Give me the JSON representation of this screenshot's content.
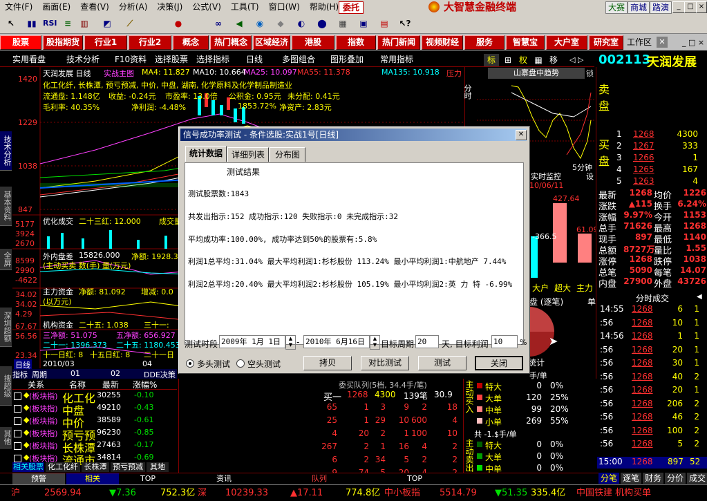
{
  "menu": [
    "文件(F)",
    "画面(E)",
    "查看(V)",
    "分析(A)",
    "决策(J)",
    "公式(V)",
    "工具(T)",
    "窗口(W)",
    "帮助(H)"
  ],
  "menu_extra": {
    "entrust": "委托",
    "brand": "大智慧金融终端",
    "links": [
      "大赛",
      "商城",
      "路演"
    ]
  },
  "toolbar_labels": {
    "rsi": "RSI"
  },
  "red_buttons": [
    "股票",
    "股指期货",
    "行业1",
    "行业2",
    "概念",
    "热门概念",
    "区域经济",
    "港股",
    "指数",
    "热门新闻",
    "视频财经",
    "服务",
    "智慧宝",
    "大户室",
    "研究室"
  ],
  "workspace_label": "工作区",
  "subbar": [
    "实用看盘",
    "技术分析",
    "F10资料",
    "选择股票",
    "选择指标",
    "日线",
    "多图组合",
    "图形叠加",
    "常用指标"
  ],
  "right_top_tabs": [
    "标",
    "权",
    "移"
  ],
  "stock": {
    "code": "002113",
    "name": "天润发展"
  },
  "left_tabs": [
    "技术分析",
    "基本资料",
    "全屏",
    "深圳超额",
    "搜超级",
    "其他"
  ],
  "chart": {
    "title_line": "天润发展 日线",
    "title_formula": "实战主图",
    "ma": [
      "MA4: 11.827",
      "MA10: 10.664",
      "MA25: 10.097",
      "MA55: 11.378",
      "MA135: 10.918"
    ],
    "pressure": "压力",
    "info1": "化工化纤, 长株潭, 预亏预减, 中价, 中盘, 湖南, 化学原料及化学制品制造业",
    "info2_a": "流通盘: 1.148亿",
    "info2_b": "收益: -0.24元",
    "info2_c": "市盈率: 13.0倍",
    "info2_d": "公积金: 0.95元",
    "info2_e": "未分配: 0.41元",
    "info3_a": "毛利率: 40.35%",
    "info3_b": "净利润: -4.48%",
    "info3_c": "净资产: 2.83元",
    "info3_mid": "1853.72%",
    "prices": [
      "1420",
      "1229",
      "1038",
      "847"
    ],
    "ind1_name": "优化成交",
    "ind1_val": "二十三红: 12.000",
    "ind1_tail": "成交量",
    "ind1_axis": [
      "5177",
      "3924",
      "2670",
      "1417"
    ],
    "ind2_name": "外内盘差",
    "ind2_val": "15826.000",
    "ind2_b": "净额: 1928.3",
    "ind2_note": "(主动买卖 数(手) 量(万元)",
    "ind2_axis": [
      "8599",
      "2990",
      "-4622",
      "-6522"
    ],
    "ind3_name": "主力资金",
    "ind3_val": "净额: 81.092",
    "ind3_b": "增减: 0.0",
    "ind3_note": "(以万元)",
    "ind3_axis": [
      "34.02",
      "54.69",
      "34.02",
      "24.82",
      "4.29"
    ],
    "ind4_name": "机构资金",
    "ind4_a": "二十五: 1.038",
    "ind4_b": "三十一:",
    "ind4_c": "三净额: 51.075",
    "ind4_d": "五净额: 656.927",
    "ind4_e": "二十一: 1396.373",
    "ind4_f": "二十五: 1180.453",
    "ind4_g": "十一日红: 8",
    "ind4_h": "十五日红: 8",
    "ind4_i": "二十一日",
    "ind4_axis": [
      "67.67",
      "56.56",
      "55.60",
      "38.58",
      "23.34"
    ],
    "period_label": "日线",
    "date_label": "2010/03",
    "tail_num": "04"
  },
  "intraday": {
    "title": "山寨盘中趋势",
    "time": "分时",
    "min5": "5分钟",
    "set": "设",
    "lock": "锁",
    "monitor": "实时监控",
    "date": "10/06/11",
    "val1": "427.64",
    "val2": "61.09",
    "val3": "-366.5",
    "labels": [
      "大户",
      "超大",
      "主力"
    ],
    "board": "盘 (逐笔)",
    "single": "单",
    "stat": "统计"
  },
  "dialog": {
    "title": "信号成功率测试 - 条件选股:实战1号[日线]",
    "tabs": [
      "统计数据",
      "详细列表",
      "分布图"
    ],
    "heading": "测试结果",
    "lines": [
      "测试股票数:1843",
      "共发出指示:152 成功指示:120 失败指示:0 未完成指示:32",
      "平均成功率:100.00%, 成功率达到50%的股票有:5.8%",
      "利润1总平均:31.04% 最大平均利润1:杉杉股份 113.24% 最小平均利润1:中航地产 7.44%",
      "利润2总平均:20.40% 最大平均利润2:杉杉股份 105.19% 最小平均利润2:英 力 特 -6.99%"
    ],
    "period_label": "测试时段",
    "date_from": "2009年 1月 1日",
    "dash": "-",
    "date_to": "2010年 6月16日",
    "target_label": "目标周期",
    "target_val": "20",
    "profit_label": "天, 目标利润",
    "profit_val": "10",
    "pct": "%",
    "radio_long": "多头测试",
    "radio_short": "空头测试",
    "buttons": [
      "拷贝",
      "对比测试",
      "测试",
      "关闭"
    ]
  },
  "quote": {
    "sell_label": "卖 盘",
    "buy_label": "买 盘",
    "buy_levels": [
      {
        "n": "1",
        "p": "1268",
        "v": "4300"
      },
      {
        "n": "2",
        "p": "1267",
        "v": "333"
      },
      {
        "n": "3",
        "p": "1266",
        "v": "1"
      },
      {
        "n": "4",
        "p": "1265",
        "v": "167"
      },
      {
        "n": "5",
        "p": "1263",
        "v": "4"
      }
    ],
    "stats": [
      {
        "l": "最新",
        "v": "1268",
        "l2": "均价",
        "v2": "1226"
      },
      {
        "l": "涨跌",
        "v": "▲115",
        "l2": "换手",
        "v2": "6.24%"
      },
      {
        "l": "涨幅",
        "v": "9.97%",
        "l2": "今开",
        "v2": "1153"
      },
      {
        "l": "总手",
        "v": "71626",
        "l2": "最高",
        "v2": "1268"
      },
      {
        "l": "现手",
        "v": "897",
        "l2": "最低",
        "v2": "1140"
      },
      {
        "l": "总额",
        "v": "8727万",
        "l2": "量比",
        "v2": "1.55"
      },
      {
        "l": "涨停",
        "v": "1268",
        "l2": "跌停",
        "v2": "1038"
      },
      {
        "l": "总笔",
        "v": "5090",
        "l2": "每笔",
        "v2": "14.07"
      },
      {
        "l": "内盘",
        "v": "27900",
        "l2": "外盘",
        "v2": "43726"
      }
    ],
    "ticks_title": "分时成交",
    "ticks": [
      {
        "t": "14:55",
        "p": "1268",
        "v": "6",
        "n": "1"
      },
      {
        "t": ":56",
        "p": "1268",
        "v": "10",
        "n": "1"
      },
      {
        "t": "14:56",
        "p": "1268",
        "v": "1",
        "n": "1"
      },
      {
        "t": ":56",
        "p": "1268",
        "v": "20",
        "n": "1"
      },
      {
        "t": ":56",
        "p": "1268",
        "v": "30",
        "n": "1"
      },
      {
        "t": ":56",
        "p": "1268",
        "v": "40",
        "n": "2"
      },
      {
        "t": ":56",
        "p": "1268",
        "v": "20",
        "n": "1"
      },
      {
        "t": ":56",
        "p": "1268",
        "v": "206",
        "n": "2"
      },
      {
        "t": ":56",
        "p": "1268",
        "v": "46",
        "n": "2"
      },
      {
        "t": ":56",
        "p": "1268",
        "v": "100",
        "n": "2"
      },
      {
        "t": ":56",
        "p": "1268",
        "v": "5",
        "n": "2"
      }
    ],
    "last_tick": {
      "t": "15:00",
      "p": "1268",
      "v": "897",
      "n": "52"
    },
    "bottom_tabs": [
      "分笔",
      "逐笔",
      "财务",
      "分价",
      "成交"
    ]
  },
  "table": {
    "headers": [
      "关系",
      "名称",
      "最新",
      "涨幅%"
    ],
    "header_tab": "指标",
    "extra_tab": "周期",
    "cols2": [
      "01",
      "02",
      "DDE决策"
    ],
    "rows": [
      {
        "rel": "(板块指)",
        "name": "化工化",
        "price": "30255",
        "chg": "-0.10"
      },
      {
        "rel": "(板块指)",
        "name": "中盘",
        "price": "49210",
        "chg": "-0.43"
      },
      {
        "rel": "(板块指)",
        "name": "中价",
        "price": "38589",
        "chg": "-0.61"
      },
      {
        "rel": "(板块指)",
        "name": "预亏预",
        "price": "96230",
        "chg": "-0.85"
      },
      {
        "rel": "(板块指)",
        "name": "长株潭",
        "price": "27463",
        "chg": "-0.17"
      },
      {
        "rel": "(板块指)",
        "name": "流通市",
        "price": "34814",
        "chg": "-0.69"
      }
    ],
    "sub_tabs": [
      "相关股票",
      "化工化纤",
      "长株潭",
      "预亏预减",
      "其地"
    ]
  },
  "orderbook": {
    "title": "委买队列(5档, 34.4手/笔)",
    "first": {
      "l": "买一",
      "p": "1268",
      "v": "4300",
      "c": "139笔",
      "a": "30.9"
    },
    "rows": [
      [
        "65",
        "1",
        "3",
        "9",
        "2",
        "18"
      ],
      [
        "25",
        "1",
        "29",
        "10",
        "600",
        "4"
      ],
      [
        "4",
        "20",
        "2",
        "1",
        "100",
        "10"
      ],
      [
        "267",
        "2",
        "1",
        "16",
        "4",
        "2"
      ],
      [
        "6",
        "2",
        "34",
        "5",
        "2",
        "2"
      ],
      [
        "9",
        "74",
        "5",
        "20",
        "4",
        "2"
      ]
    ]
  },
  "flow": {
    "buy_title": "主动买入",
    "sell_title": "主动卖出",
    "hdr": "共 -1.$手/单",
    "buy_hdr": "手/单",
    "buy": [
      {
        "l": "特大",
        "v": "0",
        "p": "0%"
      },
      {
        "l": "大单",
        "v": "120",
        "p": "25%"
      },
      {
        "l": "中单",
        "v": "99",
        "p": "20%"
      },
      {
        "l": "小单",
        "v": "269",
        "p": "55%"
      }
    ],
    "sell_hdr": "共 0单 -1.$手/单",
    "sell": [
      {
        "l": "特大",
        "v": "0",
        "p": "0%"
      },
      {
        "l": "大单",
        "v": "0",
        "p": "0%"
      },
      {
        "l": "中单",
        "v": "0",
        "p": "0%"
      },
      {
        "l": "小单",
        "v": "0",
        "p": "0%"
      }
    ]
  },
  "bottom_tabs": [
    "预警",
    "相关",
    "TOP",
    "资讯",
    "队列",
    "TOP"
  ],
  "status": {
    "sh": "沪",
    "sh_idx": "2569.94",
    "sh_chg": "▼7.36",
    "sh_amt": "752.3亿",
    "sz": "深",
    "sz_idx": "10239.33",
    "sz_chg": "▲17.11",
    "sz_amt": "774.8亿",
    "sme": "中小板指",
    "sme_idx": "5514.79",
    "sme_chg": "▼51.35",
    "sme_amt": "335.4亿",
    "ticker": "中国铁建  机构买单"
  }
}
